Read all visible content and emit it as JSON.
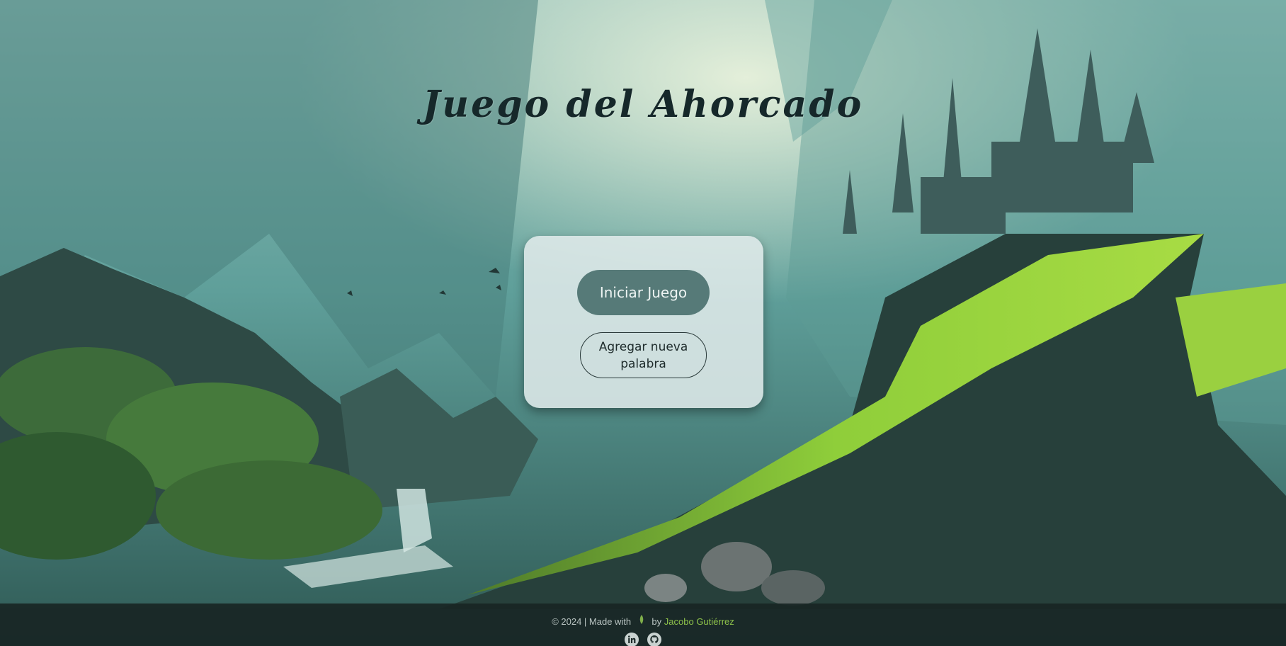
{
  "header": {
    "title": "Juego del Ahorcado"
  },
  "menu": {
    "start_label": "Iniciar Juego",
    "add_word_label": "Agregar nueva palabra"
  },
  "footer": {
    "copyright_prefix": "© 2024 | Made with",
    "by_label": "by",
    "author": "Jacobo Gutiérrez",
    "heart_icon": "leaf-icon",
    "socials": [
      {
        "name": "linkedin-icon"
      },
      {
        "name": "github-icon"
      }
    ]
  },
  "colors": {
    "title": "#16282a",
    "primary_button": "#567a78",
    "card_background": "#e2ebeb",
    "footer_background": "#182524",
    "author_link": "#8ec24a"
  }
}
